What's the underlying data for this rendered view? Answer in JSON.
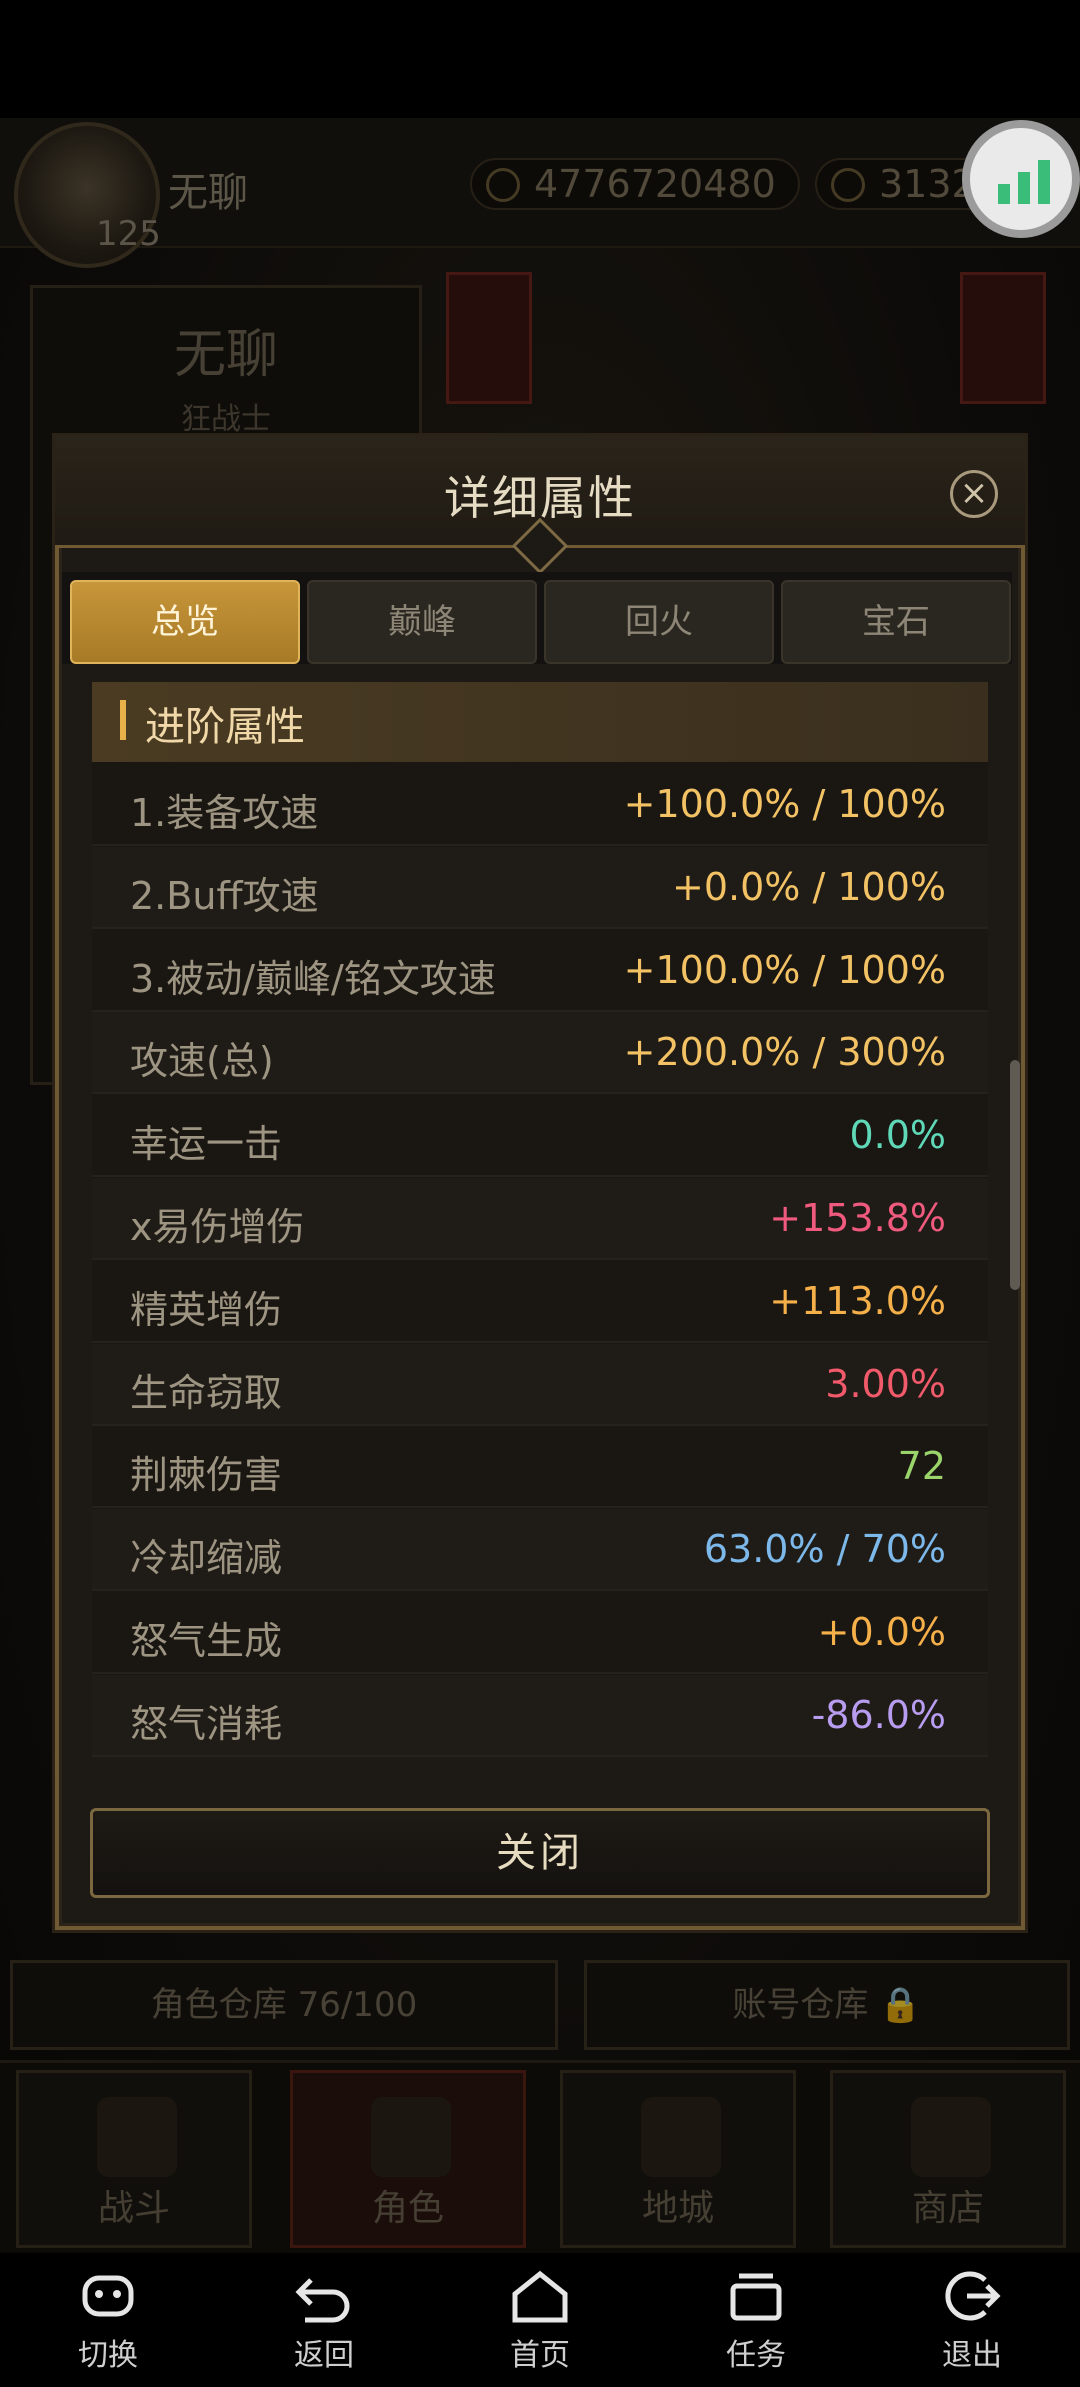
{
  "player": {
    "name": "无聊",
    "level": "125"
  },
  "currency": {
    "gold": "4776720480",
    "energy": "31325"
  },
  "character": {
    "name": "无聊",
    "class": "狂战士"
  },
  "modal": {
    "title": "详细属性",
    "tabs": [
      "总览",
      "巅峰",
      "回火",
      "宝石"
    ],
    "active_tab": "总览",
    "section_title": "进阶属性",
    "rows": [
      {
        "label": "1.装备攻速",
        "value": "+100.0% / 100%",
        "color": "#f2c265"
      },
      {
        "label": "2.Buff攻速",
        "value": "+0.0% / 100%",
        "color": "#f2c265"
      },
      {
        "label": "3.被动/巅峰/铭文攻速",
        "value": "+100.0% / 100%",
        "color": "#f2c265"
      },
      {
        "label": "攻速(总)",
        "value": "+200.0% / 300%",
        "color": "#f2c265"
      },
      {
        "label": "幸运一击",
        "value": "0.0%",
        "color": "#5fd8b8"
      },
      {
        "label": "x易伤增伤",
        "value": "+153.8%",
        "color": "#f05a7e"
      },
      {
        "label": "精英增伤",
        "value": "+113.0%",
        "color": "#f5b04a"
      },
      {
        "label": "生命窃取",
        "value": "3.00%",
        "color": "#f05a6a"
      },
      {
        "label": "荆棘伤害",
        "value": "72",
        "color": "#9ad46a"
      },
      {
        "label": "冷却缩减",
        "value": "63.0% / 70%",
        "color": "#7db8ea"
      },
      {
        "label": "怒气生成",
        "value": "+0.0%",
        "color": "#f5b04a"
      },
      {
        "label": "怒气消耗",
        "value": "-86.0%",
        "color": "#b79cf0"
      }
    ],
    "close_label": "关闭"
  },
  "storage": {
    "role": "角色仓库 76/100",
    "account": "账号仓库"
  },
  "game_tabs": [
    "战斗",
    "角色",
    "地城",
    "商店"
  ],
  "system_nav": [
    "切换",
    "返回",
    "首页",
    "任务",
    "退出"
  ]
}
